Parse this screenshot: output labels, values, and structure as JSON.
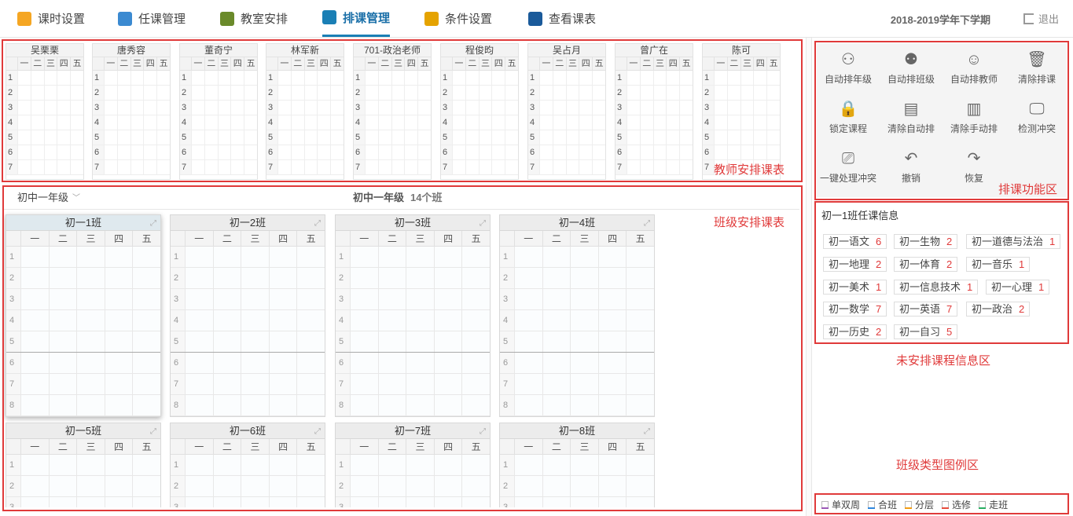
{
  "nav": {
    "items": [
      {
        "label": "课时设置",
        "icon": "clock-icon",
        "color": "#f5a623"
      },
      {
        "label": "任课管理",
        "icon": "teacher-book-icon",
        "color": "#3b8ad1"
      },
      {
        "label": "教室安排",
        "icon": "blackboard-icon",
        "color": "#6a8a2a"
      },
      {
        "label": "排课管理",
        "icon": "schedule-grid-icon",
        "color": "#1a7fb5"
      },
      {
        "label": "条件设置",
        "icon": "condition-doc-icon",
        "color": "#e5a300"
      },
      {
        "label": "查看课表",
        "icon": "search-icon",
        "color": "#1a5a9a"
      }
    ],
    "active_index": 3,
    "term": "2018-2019学年下学期",
    "logout": "退出"
  },
  "teacher_panel": {
    "days": [
      "一",
      "二",
      "三",
      "四",
      "五"
    ],
    "periods": [
      "1",
      "2",
      "3",
      "4",
      "5",
      "6",
      "7"
    ],
    "teachers": [
      "吴栗栗",
      "唐秀容",
      "董奇宁",
      "林军新",
      "701-政治老师",
      "程俊昀",
      "吴占月",
      "曾广在",
      "陈可"
    ]
  },
  "grade": {
    "selector": "初中一年级",
    "title": "初中一年级",
    "count": "14个班"
  },
  "class_panel": {
    "days": [
      "一",
      "二",
      "三",
      "四",
      "五"
    ],
    "periods": [
      "1",
      "2",
      "3",
      "4",
      "5",
      "6",
      "7",
      "8"
    ],
    "classes": [
      "初一1班",
      "初一2班",
      "初一3班",
      "初一4班",
      "初一5班",
      "初一6班",
      "初一7班",
      "初一8班"
    ]
  },
  "functions": [
    {
      "label": "自动排年级",
      "icon": "auto-grade-icon"
    },
    {
      "label": "自动排班级",
      "icon": "auto-class-icon"
    },
    {
      "label": "自动排教师",
      "icon": "auto-teacher-icon"
    },
    {
      "label": "清除排课",
      "icon": "trash-icon"
    },
    {
      "label": "锁定课程",
      "icon": "lock-icon"
    },
    {
      "label": "清除自动排",
      "icon": "clear-auto-icon"
    },
    {
      "label": "清除手动排",
      "icon": "clear-manual-icon"
    },
    {
      "label": "检测冲突",
      "icon": "monitor-check-icon"
    },
    {
      "label": "一键处理冲突",
      "icon": "resolve-conflict-icon"
    },
    {
      "label": "撤销",
      "icon": "undo-icon"
    },
    {
      "label": "恢复",
      "icon": "redo-icon"
    }
  ],
  "unscheduled": {
    "title": "初一1班任课信息",
    "items": [
      {
        "name": "初一语文",
        "count": "6"
      },
      {
        "name": "初一生物",
        "count": "2"
      },
      {
        "name": "初一道德与法治",
        "count": "1"
      },
      {
        "name": "初一地理",
        "count": "2"
      },
      {
        "name": "初一体育",
        "count": "2"
      },
      {
        "name": "初一音乐",
        "count": "1"
      },
      {
        "name": "初一美术",
        "count": "1"
      },
      {
        "name": "初一信息技术",
        "count": "1"
      },
      {
        "name": "初一心理",
        "count": "1"
      },
      {
        "name": "初一数学",
        "count": "7"
      },
      {
        "name": "初一英语",
        "count": "7"
      },
      {
        "name": "初一政治",
        "count": "2"
      },
      {
        "name": "初一历史",
        "count": "2"
      },
      {
        "name": "初一自习",
        "count": "5"
      }
    ]
  },
  "legend": [
    {
      "label": "单双周",
      "color": "#9b59b6"
    },
    {
      "label": "合班",
      "color": "#2e86de"
    },
    {
      "label": "分层",
      "color": "#f39c12"
    },
    {
      "label": "选修",
      "color": "#e74c3c"
    },
    {
      "label": "走班",
      "color": "#27ae60"
    }
  ],
  "annotations": {
    "teacher": "教师安排课表",
    "function": "排课功能区",
    "class": "班级安排课表",
    "unscheduled": "未安排课程信息区",
    "legend": "班级类型图例区"
  }
}
